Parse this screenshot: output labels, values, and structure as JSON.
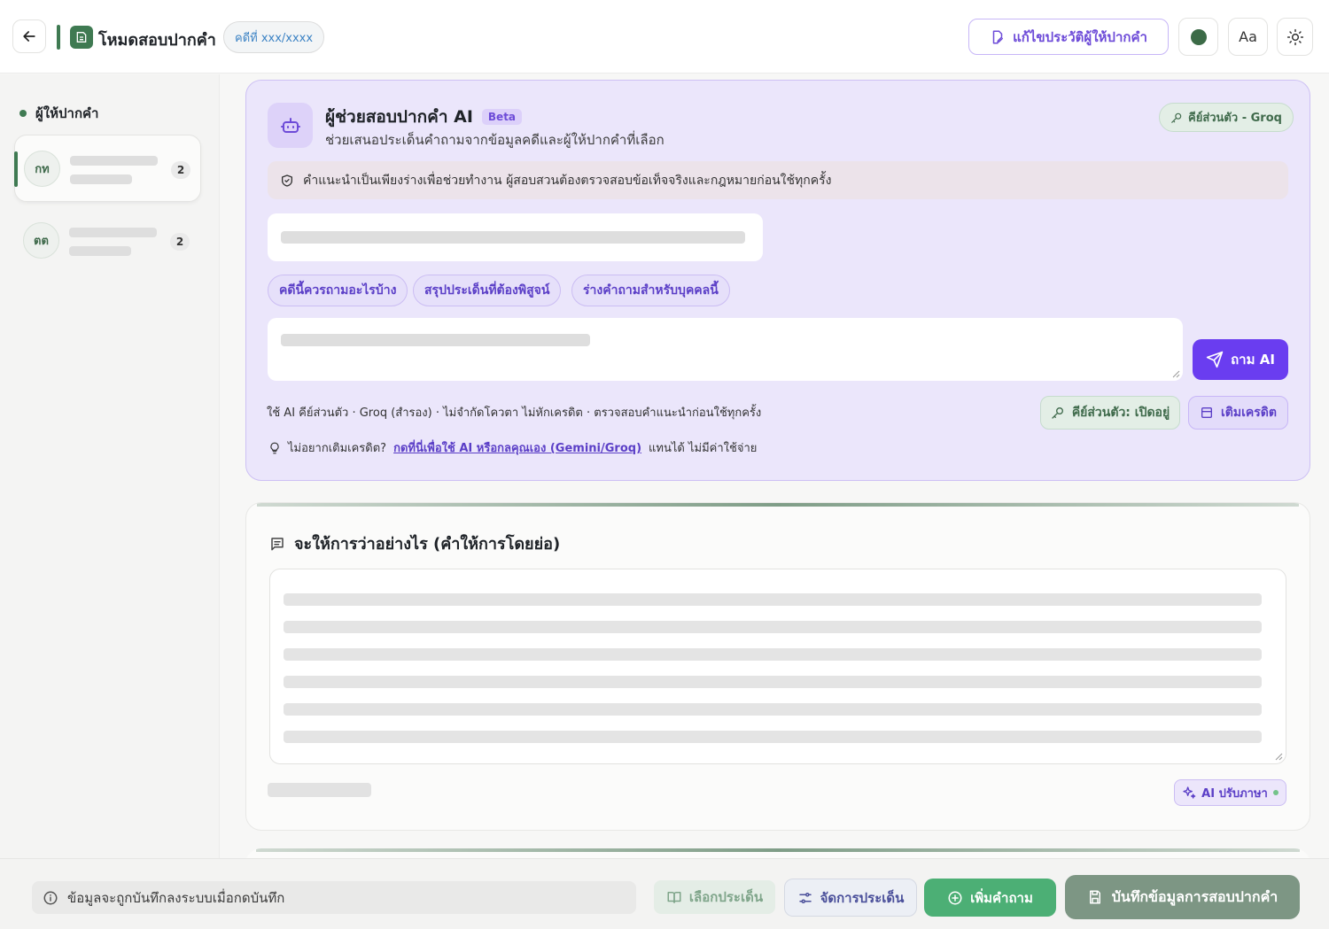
{
  "header": {
    "app_title": "โหมดสอบปากคำ",
    "case_number": "คดีที่ xxx/xxxx",
    "edit_profile_label": "แก้ไขประวัติผู้ให้ปากคำ",
    "font_size_label": "Aa"
  },
  "sidebar": {
    "heading": "ผู้ให้ปากคำ",
    "people": [
      {
        "initials": "กท",
        "count": "2",
        "active": true
      },
      {
        "initials": "ตต",
        "count": "2",
        "active": false
      }
    ]
  },
  "ai_panel": {
    "title": "ผู้ช่วยสอบปากคำ AI",
    "badge": "Beta",
    "subtitle": "ช่วยเสนอประเด็นคำถามจากข้อมูลคดีและผู้ให้ปากคำที่เลือก",
    "key_chip": "คีย์ส่วนตัว - Groq",
    "disclaimer": "คำแนะนำเป็นเพียงร่างเพื่อช่วยทำงาน ผู้สอบสวนต้องตรวจสอบข้อเท็จจริงและกฎหมายก่อนใช้ทุกครั้ง",
    "suggestions": [
      "คดีนี้ควรถามอะไรบ้าง",
      "สรุปประเด็นที่ต้องพิสูจน์",
      "ร่างคำถามสำหรับบุคคลนี้"
    ],
    "ask_label": "ถาม AI",
    "usage_text": "ใช้ AI คีย์ส่วนตัว · Groq (สำรอง) · ไม่จำกัดโควตา ไม่หักเครดิต · ตรวจสอบคำแนะนำก่อนใช้ทุกครั้ง",
    "key_open_label": "คีย์ส่วนตัว: เปิดอยู่",
    "topup_label": "เติมเครดิต",
    "tip_prefix": "ไม่อยากเติมเครดิต?",
    "tip_link": "กดที่นี่เพื่อใช้ AI หรือกลคุณเอง (Gemini/Groq)",
    "tip_suffix": "แทนได้ ไม่มีค่าใช้จ่าย"
  },
  "statement": {
    "title": "จะให้การว่าอย่างไร (คำให้การโดยย่อ)",
    "ai_polish_label": "AI ปรับภาษา"
  },
  "footer": {
    "save_notice": "ข้อมูลจะถูกบันทึกลงระบบเมื่อกดบันทึก",
    "select_issue_label": "เลือกประเด็น",
    "manage_issue_label": "จัดการประเด็น",
    "add_question_label": "เพิ่มคำถาม",
    "save_label": "บันทึกข้อมูลการสอบปากคำ"
  },
  "colors": {
    "brand_green": "#3f7a52",
    "ai_purple": "#6a3df0",
    "ai_panel_bg": "#ebe6fb"
  }
}
